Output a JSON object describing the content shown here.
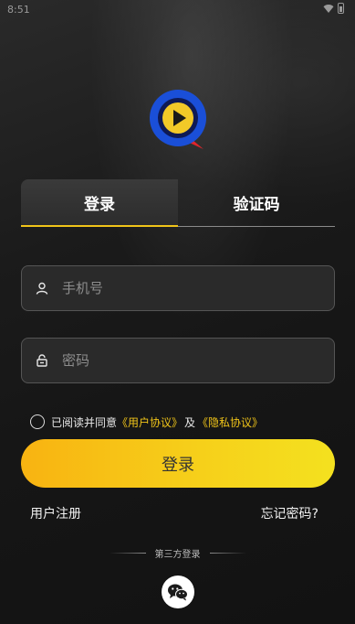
{
  "status_bar": {
    "time": "8:51"
  },
  "tabs": [
    {
      "label": "登录",
      "active": true
    },
    {
      "label": "验证码",
      "active": false
    }
  ],
  "phone_field": {
    "placeholder": "手机号",
    "value": ""
  },
  "password_field": {
    "placeholder": "密码",
    "value": ""
  },
  "agreement": {
    "prefix": "已阅读并同意",
    "user_agreement": "《用户协议》",
    "and": "及",
    "privacy_policy": "《隐私协议》",
    "checked": false
  },
  "login_button": {
    "label": "登录"
  },
  "links": {
    "register": "用户注册",
    "forgot_password": "忘记密码?"
  },
  "third_party": {
    "label": "第三方登录",
    "providers": [
      "wechat-icon"
    ]
  },
  "colors": {
    "accent": "#f0c419",
    "button_start": "#f8b311",
    "button_end": "#f4e11f",
    "logo_blue": "#1a4fd8",
    "logo_red": "#e0262b"
  }
}
